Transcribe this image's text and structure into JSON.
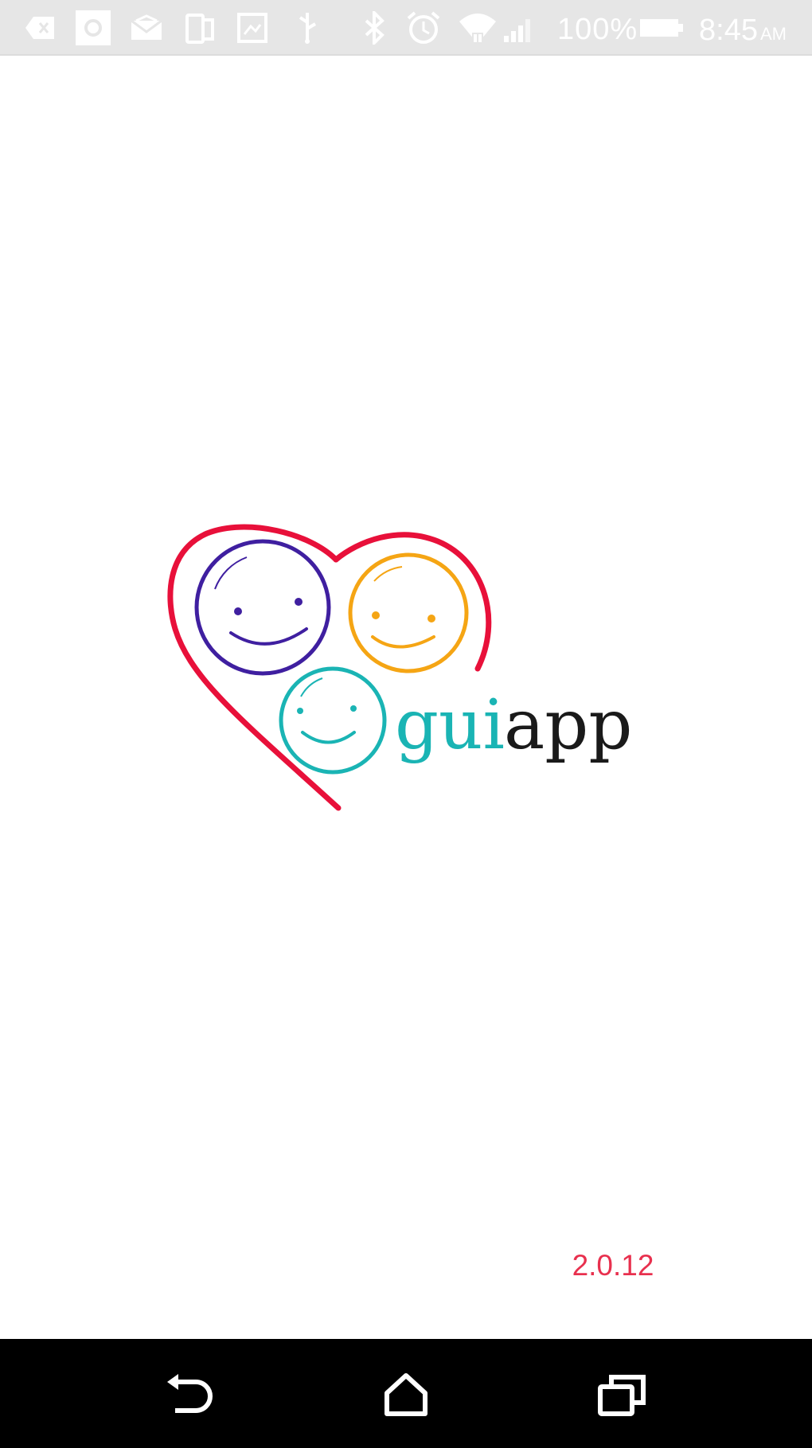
{
  "status_bar": {
    "icons": [
      "notification-back-icon",
      "notification-app-icon",
      "mail-icon",
      "phone-copy-icon",
      "image-icon",
      "usb-icon",
      "bluetooth-icon",
      "alarm-icon",
      "wifi-icon",
      "signal-icon",
      "battery-icon"
    ],
    "battery": "100%",
    "time": "8:45",
    "ampm": "AM",
    "background_color": "#e6e6e6"
  },
  "splash": {
    "logo_text_part1": "gui",
    "logo_text_part2": "app",
    "version": "2.0.12",
    "colors": {
      "heart": "#e8103a",
      "purple_face": "#3f1fa0",
      "orange_face": "#f5a514",
      "teal_face": "#1ab4b4",
      "text_dark": "#1a1a1a",
      "version": "#e8304e"
    }
  },
  "nav_bar": {
    "buttons": [
      "back-icon",
      "home-icon",
      "recent-apps-icon"
    ]
  }
}
